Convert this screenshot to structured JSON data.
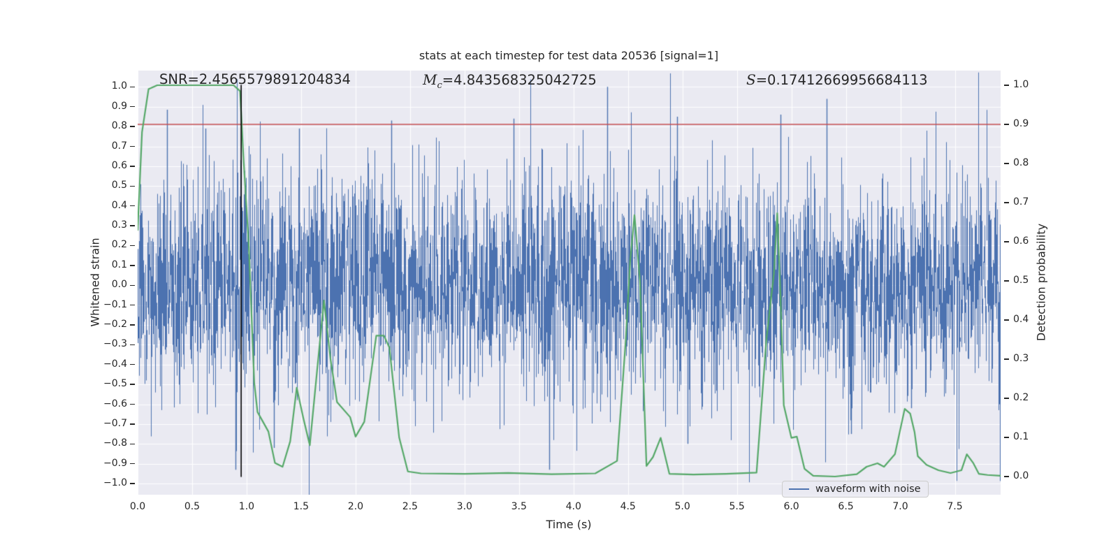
{
  "title": "stats at each timestep for test data 20536 [signal=1]",
  "annotations": {
    "snr": {
      "label": "SNR",
      "value": "=2.4565579891204834"
    },
    "chirp_mass": {
      "label": "M",
      "subscript": "c",
      "value": "=4.843568325042725"
    },
    "significance": {
      "label": "S",
      "value": "=0.17412669956684113"
    }
  },
  "axes": {
    "x": {
      "label": "Time (s)",
      "ticks": [
        {
          "v": 0.0,
          "label": "0.0"
        },
        {
          "v": 0.5,
          "label": "0.5"
        },
        {
          "v": 1.0,
          "label": "1.0"
        },
        {
          "v": 1.5,
          "label": "1.5"
        },
        {
          "v": 2.0,
          "label": "2.0"
        },
        {
          "v": 2.5,
          "label": "2.5"
        },
        {
          "v": 3.0,
          "label": "3.0"
        },
        {
          "v": 3.5,
          "label": "3.5"
        },
        {
          "v": 4.0,
          "label": "4.0"
        },
        {
          "v": 4.5,
          "label": "4.5"
        },
        {
          "v": 5.0,
          "label": "5.0"
        },
        {
          "v": 5.5,
          "label": "5.5"
        },
        {
          "v": 6.0,
          "label": "6.0"
        },
        {
          "v": 6.5,
          "label": "6.5"
        },
        {
          "v": 7.0,
          "label": "7.0"
        },
        {
          "v": 7.5,
          "label": "7.5"
        }
      ]
    },
    "y_left": {
      "label": "Whitened strain",
      "ticks": [
        {
          "v": 1.0,
          "label": "1.0"
        },
        {
          "v": 0.9,
          "label": "0.9"
        },
        {
          "v": 0.8,
          "label": "0.8"
        },
        {
          "v": 0.7,
          "label": "0.7"
        },
        {
          "v": 0.6,
          "label": "0.6"
        },
        {
          "v": 0.5,
          "label": "0.5"
        },
        {
          "v": 0.4,
          "label": "0.4"
        },
        {
          "v": 0.3,
          "label": "0.3"
        },
        {
          "v": 0.2,
          "label": "0.2"
        },
        {
          "v": 0.1,
          "label": "0.1"
        },
        {
          "v": 0.0,
          "label": "0.0"
        },
        {
          "v": -0.1,
          "label": "−0.1"
        },
        {
          "v": -0.2,
          "label": "−0.2"
        },
        {
          "v": -0.3,
          "label": "−0.3"
        },
        {
          "v": -0.4,
          "label": "−0.4"
        },
        {
          "v": -0.5,
          "label": "−0.5"
        },
        {
          "v": -0.6,
          "label": "−0.6"
        },
        {
          "v": -0.7,
          "label": "−0.7"
        },
        {
          "v": -0.8,
          "label": "−0.8"
        },
        {
          "v": -0.9,
          "label": "−0.9"
        },
        {
          "v": -1.0,
          "label": "−1.0"
        }
      ]
    },
    "y_right": {
      "label": "Detection probability",
      "ticks": [
        {
          "v": 1.0,
          "label": "1.0"
        },
        {
          "v": 0.9,
          "label": "0.9"
        },
        {
          "v": 0.8,
          "label": "0.8"
        },
        {
          "v": 0.7,
          "label": "0.7"
        },
        {
          "v": 0.6,
          "label": "0.6"
        },
        {
          "v": 0.5,
          "label": "0.5"
        },
        {
          "v": 0.4,
          "label": "0.4"
        },
        {
          "v": 0.3,
          "label": "0.3"
        },
        {
          "v": 0.2,
          "label": "0.2"
        },
        {
          "v": 0.1,
          "label": "0.1"
        },
        {
          "v": 0.0,
          "label": "0.0"
        }
      ]
    }
  },
  "legend": {
    "items": [
      {
        "label": "waveform with noise",
        "color": "#4c72b0"
      }
    ]
  },
  "colors": {
    "waveform": "#4c72b0",
    "detection_curve": "#55a868",
    "threshold_line": "#c44e52",
    "event_marker": "#000000",
    "plot_background": "#eaeaf2",
    "grid": "#ffffff",
    "text": "#262626"
  },
  "chart_data": {
    "type": "line",
    "title": "stats at each timestep for test data 20536 [signal=1]",
    "xlabel": "Time (s)",
    "ylabel_left": "Whitened strain",
    "ylabel_right": "Detection probability",
    "xlim": [
      0,
      7.92
    ],
    "ylim_left": [
      -1.056,
      1.082
    ],
    "ylim_right": [
      -0.046,
      1.037
    ],
    "grid": true,
    "legend_position": "lower-right-inside",
    "threshold": {
      "value": 0.9,
      "axis": "right",
      "color": "#c44e52"
    },
    "event_marker": {
      "time": 0.95,
      "span_right_axis": [
        0.0,
        1.0
      ],
      "color": "#000000"
    },
    "series": [
      {
        "name": "waveform with noise",
        "color": "#4c72b0",
        "kind": "stochastic-noise",
        "note": "dense whitened-strain noise, regenerated procedurally from these parameters",
        "noise": {
          "seed": 1337,
          "samples_per_column": 3,
          "std": 0.27,
          "tail_prob": 0.013,
          "tail_gain": 2.1
        },
        "notable_peaks": [
          [
            0.27,
            0.885
          ],
          [
            0.62,
            0.79
          ],
          [
            1.48,
            0.79
          ],
          [
            2.33,
            0.83
          ],
          [
            3.45,
            0.84
          ],
          [
            4.31,
            1.0
          ],
          [
            4.95,
            0.85
          ],
          [
            5.9,
            0.86
          ],
          [
            6.32,
            0.94
          ],
          [
            0.9,
            -0.93
          ],
          [
            1.25,
            -0.82
          ],
          [
            3.78,
            -0.93
          ],
          [
            5.05,
            -0.8
          ],
          [
            6.55,
            -0.75
          ],
          [
            7.1,
            -0.62
          ]
        ]
      },
      {
        "name": "detection probability",
        "color": "#55a868",
        "kind": "line",
        "points": [
          [
            0.0,
            0.63
          ],
          [
            0.04,
            0.88
          ],
          [
            0.1,
            0.99
          ],
          [
            0.18,
            1.0
          ],
          [
            0.88,
            1.0
          ],
          [
            0.94,
            0.985
          ],
          [
            0.97,
            0.82
          ],
          [
            1.02,
            0.59
          ],
          [
            1.07,
            0.24
          ],
          [
            1.1,
            0.165
          ],
          [
            1.2,
            0.115
          ],
          [
            1.26,
            0.035
          ],
          [
            1.33,
            0.025
          ],
          [
            1.4,
            0.09
          ],
          [
            1.46,
            0.227
          ],
          [
            1.52,
            0.15
          ],
          [
            1.58,
            0.08
          ],
          [
            1.65,
            0.28
          ],
          [
            1.71,
            0.45
          ],
          [
            1.77,
            0.3
          ],
          [
            1.83,
            0.19
          ],
          [
            1.95,
            0.152
          ],
          [
            2.0,
            0.102
          ],
          [
            2.08,
            0.14
          ],
          [
            2.19,
            0.36
          ],
          [
            2.26,
            0.36
          ],
          [
            2.31,
            0.33
          ],
          [
            2.4,
            0.1
          ],
          [
            2.48,
            0.013
          ],
          [
            2.6,
            0.008
          ],
          [
            3.0,
            0.007
          ],
          [
            3.4,
            0.009
          ],
          [
            3.8,
            0.006
          ],
          [
            4.2,
            0.008
          ],
          [
            4.4,
            0.04
          ],
          [
            4.48,
            0.35
          ],
          [
            4.52,
            0.55
          ],
          [
            4.56,
            0.668
          ],
          [
            4.61,
            0.5
          ],
          [
            4.67,
            0.027
          ],
          [
            4.73,
            0.05
          ],
          [
            4.8,
            0.099
          ],
          [
            4.88,
            0.007
          ],
          [
            5.1,
            0.005
          ],
          [
            5.4,
            0.007
          ],
          [
            5.68,
            0.01
          ],
          [
            5.77,
            0.349
          ],
          [
            5.84,
            0.52
          ],
          [
            5.87,
            0.673
          ],
          [
            5.9,
            0.46
          ],
          [
            5.93,
            0.182
          ],
          [
            6.0,
            0.099
          ],
          [
            6.05,
            0.102
          ],
          [
            6.12,
            0.02
          ],
          [
            6.2,
            0.002
          ],
          [
            6.4,
            0.0
          ],
          [
            6.6,
            0.006
          ],
          [
            6.69,
            0.025
          ],
          [
            6.79,
            0.034
          ],
          [
            6.85,
            0.025
          ],
          [
            6.95,
            0.057
          ],
          [
            7.04,
            0.173
          ],
          [
            7.09,
            0.161
          ],
          [
            7.13,
            0.114
          ],
          [
            7.16,
            0.052
          ],
          [
            7.24,
            0.03
          ],
          [
            7.35,
            0.016
          ],
          [
            7.46,
            0.009
          ],
          [
            7.56,
            0.016
          ],
          [
            7.61,
            0.057
          ],
          [
            7.67,
            0.034
          ],
          [
            7.72,
            0.007
          ],
          [
            7.8,
            0.004
          ],
          [
            7.92,
            0.002
          ]
        ]
      }
    ],
    "stats": {
      "SNR": 2.4565579891204834,
      "chirp_mass_Mc": 4.843568325042725,
      "S": 0.17412669956684113
    }
  }
}
